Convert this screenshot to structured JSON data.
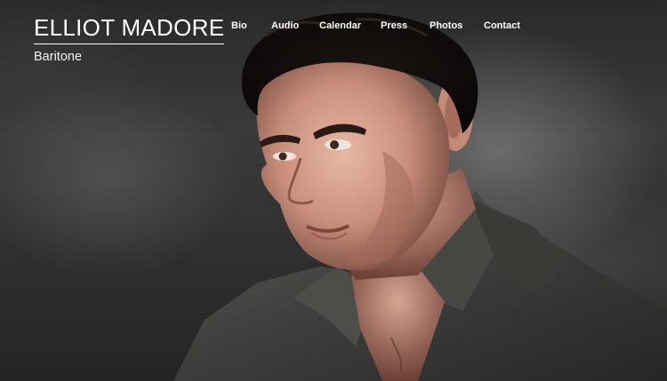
{
  "site": {
    "title": "ELLIOT MADORE",
    "subtitle": "Baritone"
  },
  "nav": {
    "items": [
      {
        "label": "Bio"
      },
      {
        "label": "Audio"
      },
      {
        "label": "Calendar"
      },
      {
        "label": "Press"
      },
      {
        "label": "Photos"
      },
      {
        "label": "Contact"
      }
    ]
  },
  "hero": {
    "image": "portrait-photo",
    "colors": {
      "background": "#2a2a2a",
      "text": "#ffffff"
    }
  }
}
